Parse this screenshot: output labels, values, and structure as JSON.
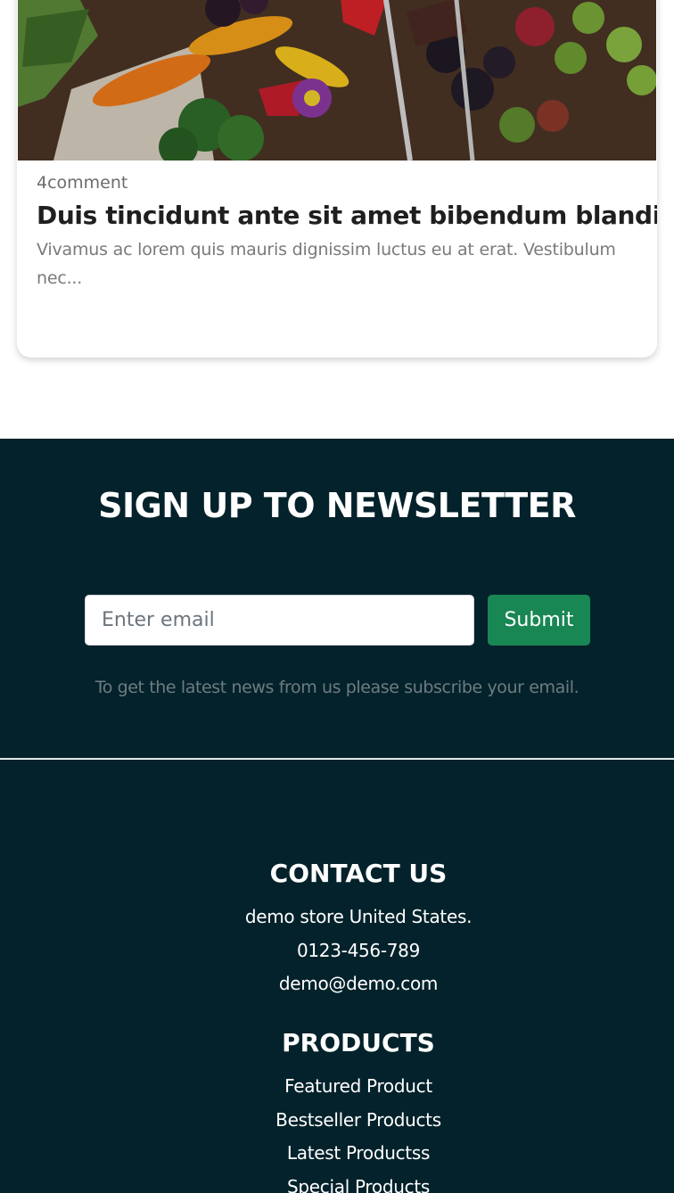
{
  "blog_card": {
    "comments": "4comment",
    "title": "Duis tincidunt ante sit amet bibendum blandit",
    "excerpt": "Vivamus ac lorem quis mauris dignissim luctus eu at erat. Vestibulum nec..."
  },
  "newsletter": {
    "title": "SIGN UP TO NEWSLETTER",
    "email_placeholder": "Enter email",
    "submit_label": "Submit",
    "note": "To get the latest news from us please subscribe your email."
  },
  "footer": {
    "contact": {
      "heading": "CONTACT US",
      "address": "demo store United States.",
      "phone": "0123-456-789",
      "email": "demo@demo.com"
    },
    "products": {
      "heading": "PRODUCTS",
      "links": [
        "Featured Product",
        "Bestseller Products",
        "Latest Productss",
        "Special Products"
      ]
    }
  },
  "colors": {
    "footer_bg": "#04222b",
    "submit_bg": "#198754"
  }
}
